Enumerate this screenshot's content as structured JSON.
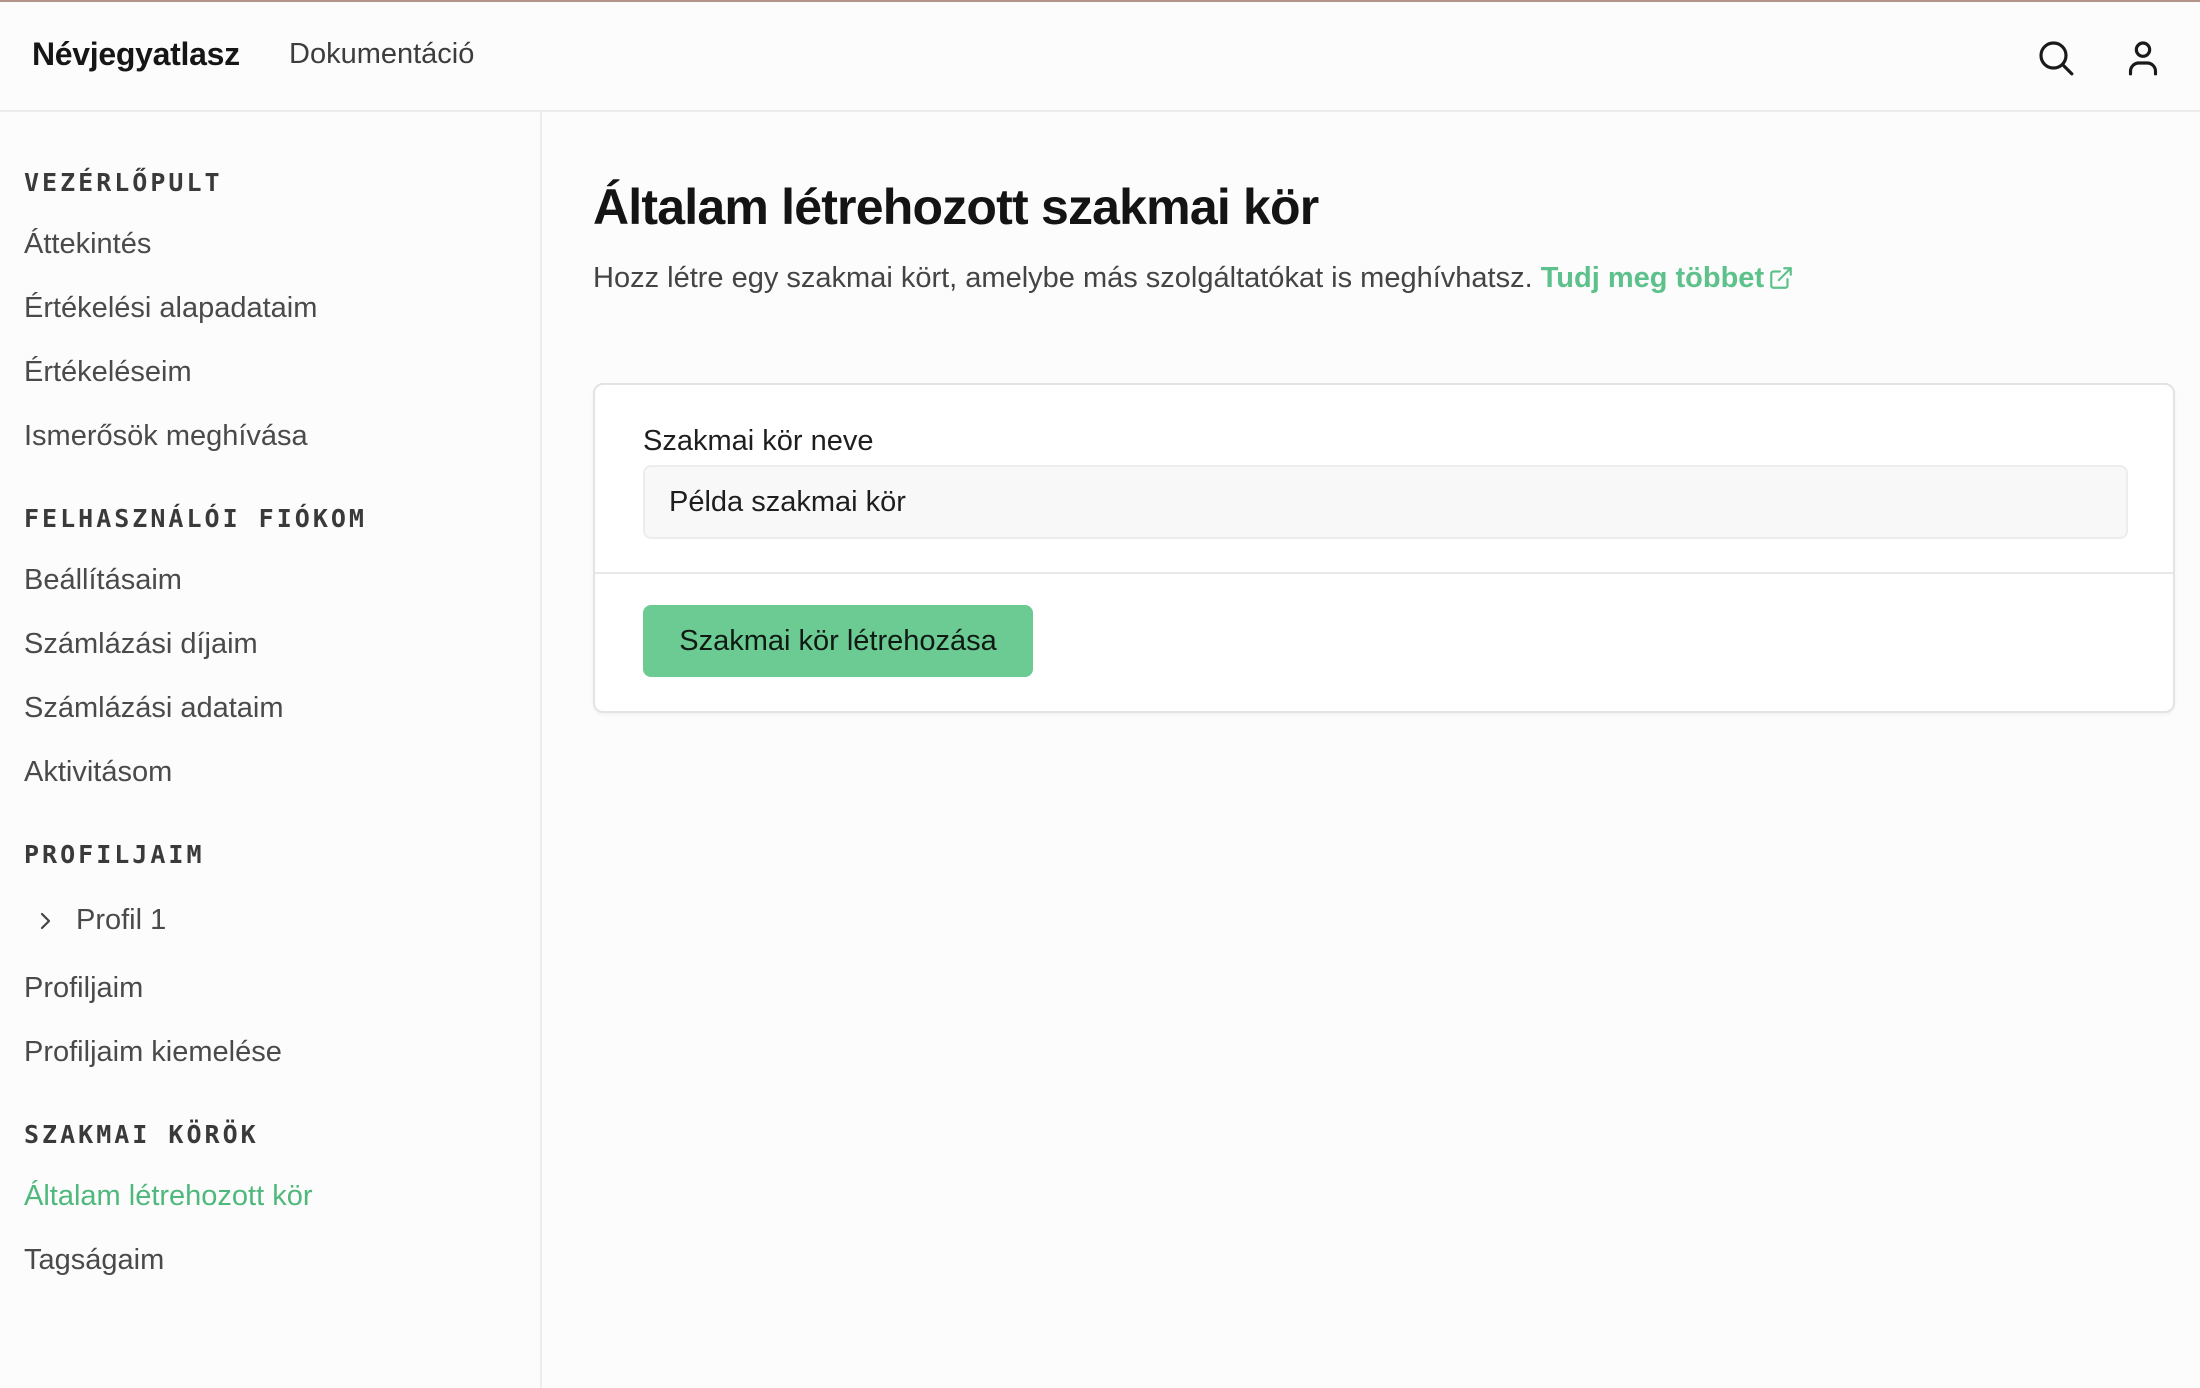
{
  "header": {
    "brand": "Névjegyatlasz",
    "nav_docs": "Dokumentáció",
    "search_icon": "search-icon",
    "user_icon": "user-icon"
  },
  "sidebar": {
    "sections": [
      {
        "heading": "VEZÉRLŐPULT",
        "items": [
          "Áttekintés",
          "Értékelési alapadataim",
          "Értékeléseim",
          "Ismerősök meghívása"
        ]
      },
      {
        "heading": "FELHASZNÁLÓI FIÓKOM",
        "items": [
          "Beállításaim",
          "Számlázási díjaim",
          "Számlázási adataim",
          "Aktivitásom"
        ]
      },
      {
        "heading": "PROFILJAIM",
        "collapsible": "Profil 1",
        "items": [
          "Profiljaim",
          "Profiljaim kiemelése"
        ]
      },
      {
        "heading": "SZAKMAI KÖRÖK",
        "items": [
          "Általam létrehozott kör",
          "Tagságaim"
        ],
        "active": "Általam létrehozott kör"
      }
    ]
  },
  "main": {
    "title": "Általam létrehozott szakmai kör",
    "description": "Hozz létre egy szakmai kört, amelybe más szolgáltatókat is meghívhatsz.",
    "learn_more": "Tudj meg többet",
    "form": {
      "label": "Szakmai kör neve",
      "value": "Példa szakmai kör",
      "submit": "Szakmai kör létrehozása"
    }
  },
  "colors": {
    "accent": "#5cc18a",
    "button": "#6ccb93",
    "active_nav": "#4fb87c",
    "top_accent": "#b3948a"
  }
}
